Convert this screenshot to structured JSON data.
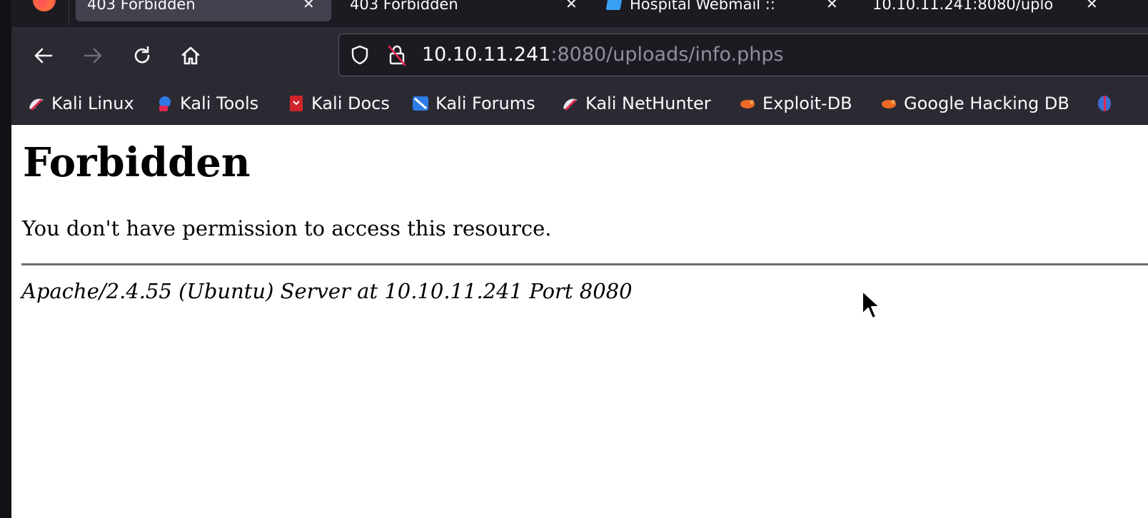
{
  "tabs": [
    {
      "title": "403 Forbidden",
      "active": true
    },
    {
      "title": "403 Forbidden",
      "active": false
    },
    {
      "title": "Hospital Webmail :: ",
      "active": false
    },
    {
      "title": "10.10.11.241:8080/uplo",
      "active": false
    }
  ],
  "toolbar": {
    "back_icon": "arrow-left-icon",
    "forward_icon": "arrow-right-icon",
    "reload_icon": "reload-icon",
    "home_icon": "home-icon"
  },
  "urlbar": {
    "host": "10.10.11.241",
    "rest": ":8080/uploads/info.phps"
  },
  "bookmarks": [
    {
      "label": "Kali Linux",
      "icon": "kali-dragon-icon"
    },
    {
      "label": "Kali Tools",
      "icon": "kali-tools-icon"
    },
    {
      "label": "Kali Docs",
      "icon": "kali-docs-icon"
    },
    {
      "label": "Kali Forums",
      "icon": "kali-forums-icon"
    },
    {
      "label": "Kali NetHunter",
      "icon": "kali-dragon-icon"
    },
    {
      "label": "Exploit-DB",
      "icon": "exploit-db-icon"
    },
    {
      "label": "Google Hacking DB",
      "icon": "exploit-db-icon"
    }
  ],
  "page": {
    "heading": "Forbidden",
    "message": "You don't have permission to access this resource.",
    "server_signature": "Apache/2.4.55 (Ubuntu) Server at 10.10.11.241 Port 8080"
  },
  "colors": {
    "chrome_dark": "#1c1b22",
    "chrome_toolbar": "#2b2a33",
    "active_tab": "#42414d",
    "url_dim": "#8f8f9d"
  }
}
